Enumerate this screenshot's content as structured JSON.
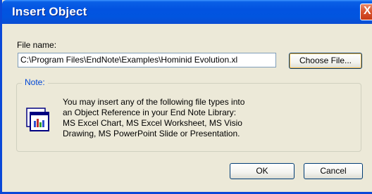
{
  "window": {
    "title": "Insert Object",
    "close_label": "X"
  },
  "file": {
    "label": "File name:",
    "value": "C:\\Program Files\\EndNote\\Examples\\Hominid Evolution.xl",
    "choose_label": "Choose File..."
  },
  "note": {
    "legend": "Note:",
    "lines": [
      "You may insert any of the following file types into",
      "an Object Reference in your End Note Library:",
      "MS Excel Chart, MS Excel Worksheet, MS Visio",
      "Drawing, MS PowerPoint Slide or Presentation."
    ],
    "icon": "object-chart-icon"
  },
  "buttons": {
    "ok_label": "OK",
    "cancel_label": "Cancel"
  },
  "colors": {
    "titlebar": "#0253e0",
    "close": "#d8522c",
    "dialog_bg": "#ece9d8",
    "note_legend": "#0046d5"
  }
}
